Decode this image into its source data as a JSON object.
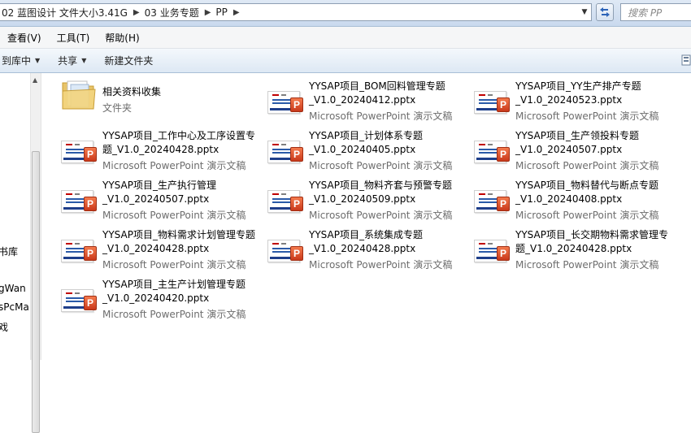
{
  "breadcrumb": [
    "02 蓝图设计 文件大小3.41G",
    "03 业务专题",
    "PP"
  ],
  "search": {
    "placeholder": "搜索 PP"
  },
  "menu": [
    "查看(V)",
    "工具(T)",
    "帮助(H)"
  ],
  "toolbar": {
    "buttons": [
      "到库中",
      "共享",
      "新建文件夹"
    ]
  },
  "nav": {
    "items": [
      "书库",
      "gWan",
      "sPcMa",
      "戏"
    ]
  },
  "folder": {
    "name": "相关资料收集",
    "type": "文件夹"
  },
  "files": [
    {
      "line1": "YYSAP项目_BOM回料管理专题",
      "line2": "_V1.0_20240412.pptx",
      "type": "Microsoft PowerPoint 演示文稿"
    },
    {
      "line1": "YYSAP项目_YY生产排产专题",
      "line2": "_V1.0_20240523.pptx",
      "type": "Microsoft PowerPoint 演示文稿"
    },
    {
      "line1": "YYSAP项目_工作中心及工序设置专",
      "line2": "题_V1.0_20240428.pptx",
      "type": "Microsoft PowerPoint 演示文稿"
    },
    {
      "line1": "YYSAP项目_计划体系专题",
      "line2": "_V1.0_20240405.pptx",
      "type": "Microsoft PowerPoint 演示文稿"
    },
    {
      "line1": "YYSAP项目_生产领投料专题",
      "line2": "_V1.0_20240507.pptx",
      "type": "Microsoft PowerPoint 演示文稿"
    },
    {
      "line1": "YYSAP项目_生产执行管理",
      "line2": "_V1.0_20240507.pptx",
      "type": "Microsoft PowerPoint 演示文稿"
    },
    {
      "line1": "YYSAP项目_物料齐套与预警专题",
      "line2": "_V1.0_20240509.pptx",
      "type": "Microsoft PowerPoint 演示文稿"
    },
    {
      "line1": "YYSAP项目_物料替代与断点专题",
      "line2": "_V1.0_20240408.pptx",
      "type": "Microsoft PowerPoint 演示文稿"
    },
    {
      "line1": "YYSAP项目_物料需求计划管理专题",
      "line2": "_V1.0_20240428.pptx",
      "type": "Microsoft PowerPoint 演示文稿"
    },
    {
      "line1": "YYSAP项目_系统集成专题",
      "line2": "_V1.0_20240428.pptx",
      "type": "Microsoft PowerPoint 演示文稿"
    },
    {
      "line1": "YYSAP项目_长交期物料需求管理专",
      "line2": "题_V1.0_20240428.pptx",
      "type": "Microsoft PowerPoint 演示文稿"
    },
    {
      "line1": "YYSAP项目_主生产计划管理专题",
      "line2": "_V1.0_20240420.pptx",
      "type": "Microsoft PowerPoint 演示文稿"
    }
  ],
  "icons": {
    "folder": "folder-icon",
    "file": "pptx-file-icon",
    "refresh": "refresh-icon",
    "search": "search-icon"
  }
}
